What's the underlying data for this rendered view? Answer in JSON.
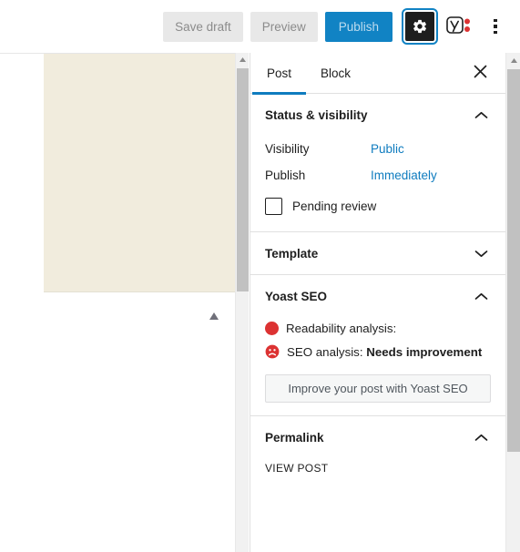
{
  "toolbar": {
    "save_draft_label": "Save draft",
    "preview_label": "Preview",
    "publish_label": "Publish",
    "settings_icon": "gear-icon",
    "yoast_icon": "yoast-seo-icon",
    "more_icon": "three-vertical-dots-icon",
    "accent_color": "#1183c4",
    "gear_button_bg": "#1e1e1e",
    "focus_ring_color": "#1183c4"
  },
  "editor": {
    "block_color": "#f1ecdd",
    "scroll_up_icon": "triangle-up-icon"
  },
  "sidebar": {
    "tabs": [
      {
        "label": "Post",
        "active": true
      },
      {
        "label": "Block",
        "active": false
      }
    ],
    "close_icon": "close-icon",
    "link_color": "#0f7cbf",
    "panels": [
      {
        "title": "Status & visibility",
        "expanded": true,
        "chevron": "chevron-up-icon",
        "rows": [
          {
            "label": "Visibility",
            "value": "Public"
          },
          {
            "label": "Publish",
            "value": "Immediately"
          }
        ],
        "checkbox": {
          "label": "Pending review",
          "checked": false
        }
      },
      {
        "title": "Template",
        "expanded": false,
        "chevron": "chevron-down-icon"
      },
      {
        "title": "Yoast SEO",
        "expanded": true,
        "chevron": "chevron-up-icon",
        "readability": {
          "icon": "red-circle-icon",
          "label": "Readability analysis:",
          "score": ""
        },
        "seo": {
          "icon": "red-sad-face-icon",
          "label": "SEO analysis:",
          "score": "Needs improvement"
        },
        "button_label": "Improve your post with Yoast SEO",
        "status_color": "#dc3232"
      },
      {
        "title": "Permalink",
        "expanded": true,
        "chevron": "chevron-up-icon",
        "view_post_label": "VIEW POST"
      }
    ]
  }
}
